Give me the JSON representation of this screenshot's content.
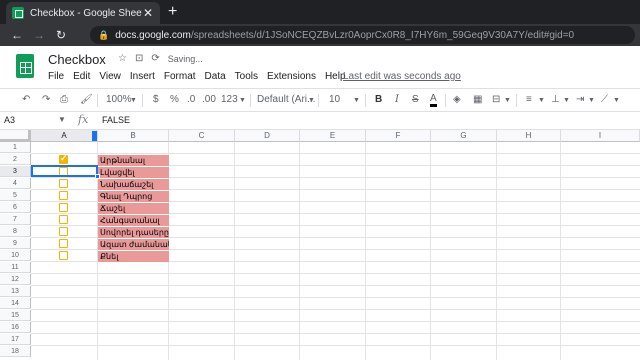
{
  "browser": {
    "tab_title": "Checkbox - Google Sheets",
    "tab_close": "✕",
    "new_tab": "+",
    "url_host": "docs.google.com",
    "url_path": "/spreadsheets/d/1JSoNCEQZBvLzr0AoprCx0R8_I7HY6m_59Geq9V30A7Y/edit#gid=0"
  },
  "app": {
    "doc_title": "Checkbox",
    "saving_text": "Saving...",
    "menu": [
      "File",
      "Edit",
      "View",
      "Insert",
      "Format",
      "Data",
      "Tools",
      "Extensions",
      "Help"
    ],
    "last_edit": "Last edit was seconds ago"
  },
  "toolbar": {
    "zoom": "100%",
    "currency": "$",
    "percent": "%",
    "dec_decrease": ".0",
    "dec_increase": ".00",
    "more_formats": "123",
    "font": "Default (Ari...",
    "font_size": "10",
    "bold": "B",
    "italic": "I",
    "strike": "S",
    "text_color": "A"
  },
  "formula_bar": {
    "name_box": "A3",
    "fx": "fx",
    "value": "FALSE"
  },
  "columns": [
    "A",
    "B",
    "C",
    "D",
    "E",
    "F",
    "G",
    "H",
    "I"
  ],
  "rows": [
    "1",
    "2",
    "3",
    "4",
    "5",
    "6",
    "7",
    "8",
    "9",
    "10",
    "11",
    "12",
    "13",
    "14",
    "15",
    "16",
    "17",
    "18"
  ],
  "cells_b": [
    "Արթնանալ",
    "Լվացվել",
    "Նախաճաշել",
    "Գնալ Դպրոց",
    "Ճաշել",
    "Հանգստանալ",
    "Սովորել դասերը",
    "Ազատ ժամանակ",
    "Քնել"
  ],
  "checkboxes": [
    true,
    false,
    false,
    false,
    false,
    false,
    false,
    false,
    false
  ],
  "colors": {
    "checkbox": "#f4b400",
    "highlight": "#ea9999",
    "selection": "#1a73e8"
  }
}
